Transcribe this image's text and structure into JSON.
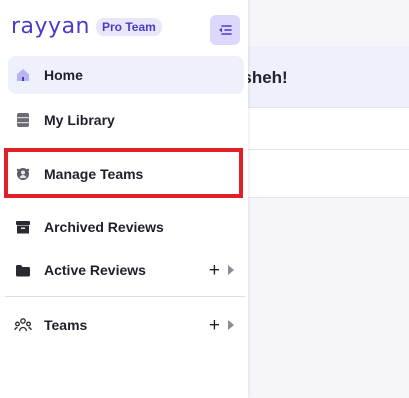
{
  "background": {
    "greeting_fragment": "osheh!"
  },
  "sidebar": {
    "logo": "rayyan",
    "badge": "Pro Team",
    "items": [
      {
        "label": "Home"
      },
      {
        "label": "My Library"
      },
      {
        "label": "Manage Teams"
      },
      {
        "label": "Archived Reviews"
      },
      {
        "label": "Active Reviews",
        "add": "+"
      },
      {
        "label": "Teams",
        "add": "+"
      }
    ]
  },
  "colors": {
    "accent": "#4a3cc8",
    "badge_bg": "#e8e6fb",
    "highlight": "#e01f26",
    "active_bg": "#eef0fb"
  }
}
